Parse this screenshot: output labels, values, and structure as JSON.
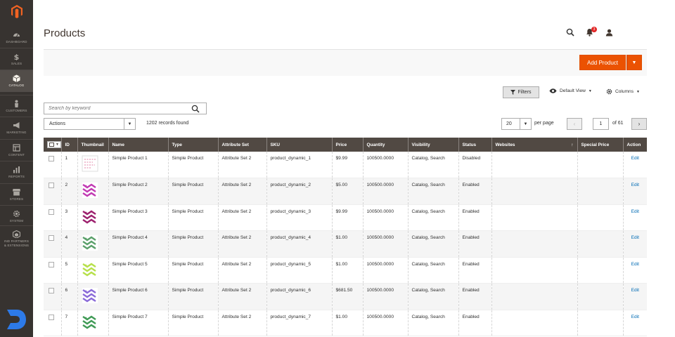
{
  "sidebar": {
    "items": [
      {
        "label": "Dashboard",
        "icon": "speedometer-icon"
      },
      {
        "label": "Sales",
        "icon": "dollar-icon"
      },
      {
        "label": "Catalog",
        "icon": "box-icon",
        "active": true
      },
      {
        "label": "Customers",
        "icon": "person-icon"
      },
      {
        "label": "Marketing",
        "icon": "megaphone-icon"
      },
      {
        "label": "Content",
        "icon": "layout-icon"
      },
      {
        "label": "Reports",
        "icon": "bar-chart-icon"
      },
      {
        "label": "Stores",
        "icon": "store-icon"
      },
      {
        "label": "System",
        "icon": "gear-icon"
      },
      {
        "label": "Find Partners & Extensions",
        "label_line1": "IND PARTNERS",
        "label_line2": "& EXTENSIONS",
        "icon": "cube-stack-icon"
      }
    ]
  },
  "header": {
    "title": "Products",
    "notification_count": "3"
  },
  "actions": {
    "add_product": "Add Product"
  },
  "toolbar": {
    "filters": "Filters",
    "view": "Default View",
    "columns": "Columns",
    "search_placeholder": "Search by keyword",
    "mass_action": "Actions",
    "records": "1202 records found",
    "per_page_value": "20",
    "per_page_label": "per page",
    "page_value": "1",
    "page_of": "of 61"
  },
  "grid": {
    "columns": [
      "ID",
      "Thumbnail",
      "Name",
      "Type",
      "Attribute Set",
      "SKU",
      "Price",
      "Quantity",
      "Visibility",
      "Status",
      "Websites",
      "Special Price",
      "Action"
    ],
    "rows": [
      {
        "id": "1",
        "name": "Simple Product 1",
        "type": "Simple Product",
        "attr_set": "Attribute Set 2",
        "sku": "product_dynamic_1",
        "price": "$9.99",
        "qty": "100500.0000",
        "visibility": "Catalog, Search",
        "status": "Disabled",
        "websites": "",
        "special_price": "",
        "action": "Edit",
        "thumb_color": "#e89ab8"
      },
      {
        "id": "2",
        "name": "Simple Product 2",
        "type": "Simple Product",
        "attr_set": "Attribute Set 2",
        "sku": "product_dynamic_2",
        "price": "$5.00",
        "qty": "100500.0000",
        "visibility": "Catalog, Search",
        "status": "Enabled",
        "websites": "",
        "special_price": "",
        "action": "Edit",
        "thumb_color": "#c13ab3"
      },
      {
        "id": "3",
        "name": "Simple Product 3",
        "type": "Simple Product",
        "attr_set": "Attribute Set 2",
        "sku": "product_dynamic_3",
        "price": "$9.99",
        "qty": "100500.0000",
        "visibility": "Catalog, Search",
        "status": "Enabled",
        "websites": "",
        "special_price": "",
        "action": "Edit",
        "thumb_color": "#9c1f6d"
      },
      {
        "id": "4",
        "name": "Simple Product 4",
        "type": "Simple Product",
        "attr_set": "Attribute Set 2",
        "sku": "product_dynamic_4",
        "price": "$1.00",
        "qty": "100500.0000",
        "visibility": "Catalog, Search",
        "status": "Enabled",
        "websites": "",
        "special_price": "",
        "action": "Edit",
        "thumb_color": "#5aa06a"
      },
      {
        "id": "5",
        "name": "Simple Product 5",
        "type": "Simple Product",
        "attr_set": "Attribute Set 2",
        "sku": "product_dynamic_5",
        "price": "$1.00",
        "qty": "100500.0000",
        "visibility": "Catalog, Search",
        "status": "Enabled",
        "websites": "",
        "special_price": "",
        "action": "Edit",
        "thumb_color": "#b6e04a"
      },
      {
        "id": "6",
        "name": "Simple Product 6",
        "type": "Simple Product",
        "attr_set": "Attribute Set 2",
        "sku": "product_dynamic_6",
        "price": "$681.50",
        "qty": "100500.0000",
        "visibility": "Catalog, Search",
        "status": "Enabled",
        "websites": "",
        "special_price": "",
        "action": "Edit",
        "thumb_color": "#8a6ad8"
      },
      {
        "id": "7",
        "name": "Simple Product 7",
        "type": "Simple Product",
        "attr_set": "Attribute Set 2",
        "sku": "product_dynamic_7",
        "price": "$1.00",
        "qty": "100500.0000",
        "visibility": "Catalog, Search",
        "status": "Enabled",
        "websites": "",
        "special_price": "",
        "action": "Edit",
        "thumb_color": "#3f9a55"
      }
    ]
  },
  "colors": {
    "sidebar_bg": "#373330",
    "accent": "#eb5202",
    "grid_header": "#514943",
    "link": "#006bb4"
  }
}
